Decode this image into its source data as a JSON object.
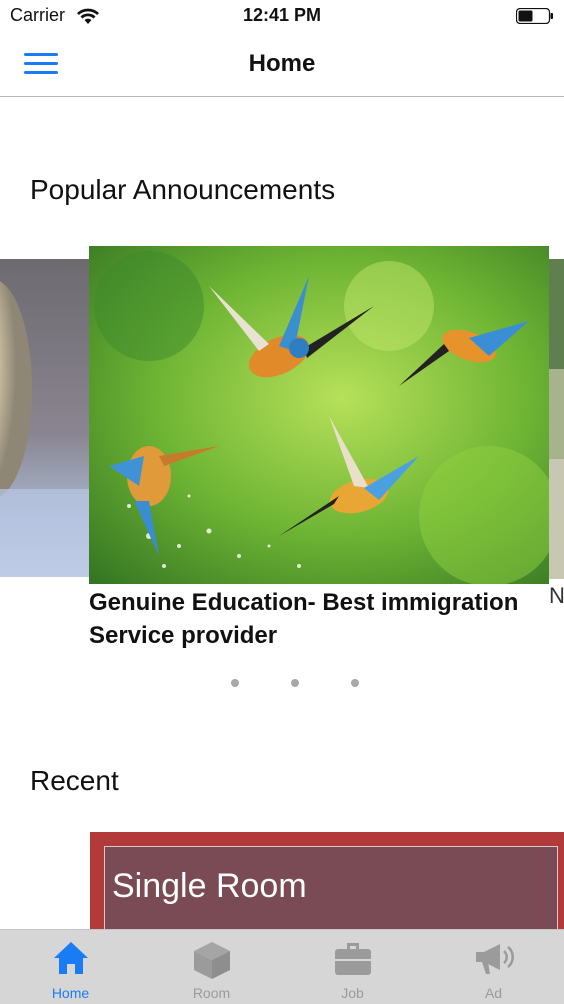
{
  "status_bar": {
    "carrier": "Carrier",
    "time": "12:41 PM"
  },
  "nav": {
    "title": "Home"
  },
  "popular": {
    "title": "Popular Announcements",
    "cards": [
      {
        "title": ""
      },
      {
        "title": "Genuine Education- Best immigration Service provider"
      },
      {
        "title": "N tr"
      }
    ],
    "page_count": 3
  },
  "recent": {
    "title": "Recent",
    "items": [
      {
        "title": "Single Room"
      }
    ]
  },
  "tabs": [
    {
      "label": "Home",
      "icon": "home-icon",
      "active": true
    },
    {
      "label": "Room",
      "icon": "cube-icon",
      "active": false
    },
    {
      "label": "Job",
      "icon": "briefcase-icon",
      "active": false
    },
    {
      "label": "Ad",
      "icon": "megaphone-icon",
      "active": false
    }
  ],
  "colors": {
    "accent": "#1a7cf5",
    "tab_inactive": "#9b9b9b",
    "tab_bar_bg": "#d6d6d6",
    "recent_card": "#b23a3a"
  }
}
